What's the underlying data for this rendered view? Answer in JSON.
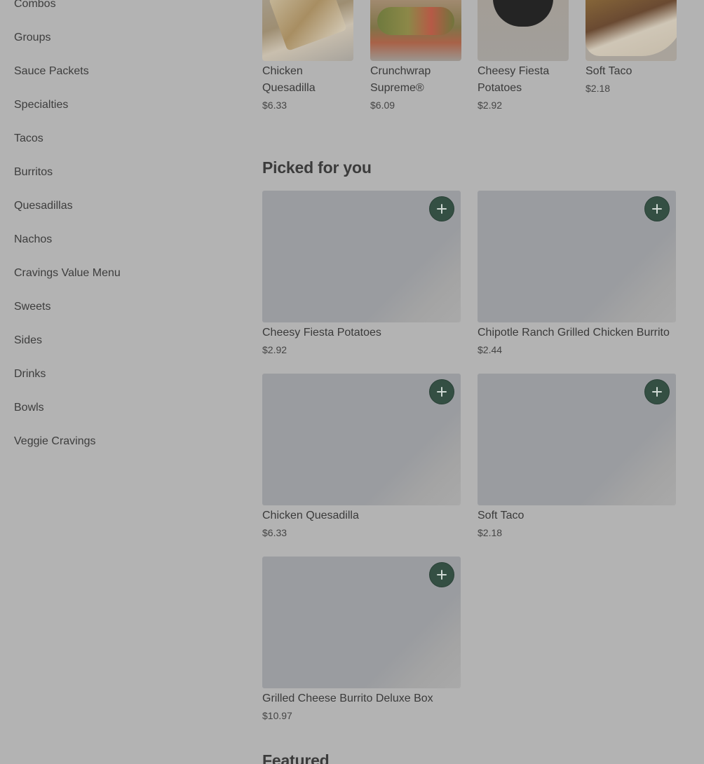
{
  "sidebar": {
    "items": [
      {
        "label": "Combos"
      },
      {
        "label": "Groups"
      },
      {
        "label": "Sauce Packets"
      },
      {
        "label": "Specialties"
      },
      {
        "label": "Tacos"
      },
      {
        "label": "Burritos"
      },
      {
        "label": "Quesadillas"
      },
      {
        "label": "Nachos"
      },
      {
        "label": "Cravings Value Menu"
      },
      {
        "label": "Sweets"
      },
      {
        "label": "Sides"
      },
      {
        "label": "Drinks"
      },
      {
        "label": "Bowls"
      },
      {
        "label": "Veggie Cravings"
      }
    ]
  },
  "top_row": {
    "items": [
      {
        "name_line1": "Chicken",
        "name_line2": "Quesadilla",
        "price": "$6.33"
      },
      {
        "name_line1": "Crunchwrap",
        "name_line2": "Supreme®",
        "price": "$6.09"
      },
      {
        "name_line1": "Cheesy Fiesta",
        "name_line2": "Potatoes",
        "price": "$2.92"
      },
      {
        "name_line1": "Soft Taco",
        "name_line2": "",
        "price": "$2.18"
      }
    ]
  },
  "picked": {
    "title": "Picked for you",
    "items": [
      {
        "name": "Cheesy Fiesta Potatoes",
        "price": "$2.92"
      },
      {
        "name": "Chipotle Ranch Grilled Chicken Burrito",
        "price": "$2.44"
      },
      {
        "name": "Chicken Quesadilla",
        "price": "$6.33"
      },
      {
        "name": "Soft Taco",
        "price": "$2.18"
      },
      {
        "name": "Grilled Cheese Burrito Deluxe Box",
        "price": "$10.97"
      }
    ]
  },
  "featured": {
    "title": "Featured"
  },
  "colors": {
    "overlay_background": "#b3b3b3",
    "add_button": "#344f43"
  },
  "icons": {
    "add": "plus-icon"
  }
}
